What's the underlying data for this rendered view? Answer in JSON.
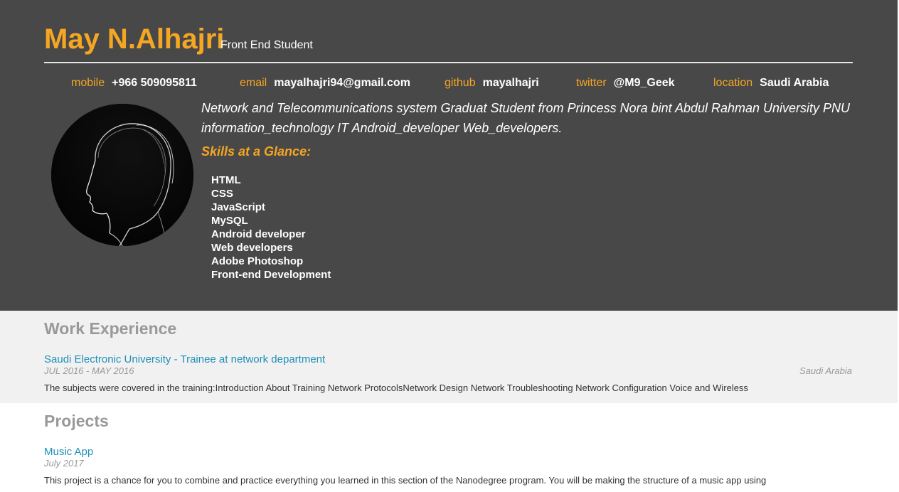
{
  "header": {
    "name": "May N.Alhajri",
    "role": "Front End Student",
    "contacts": [
      {
        "label": "mobile",
        "value": "+966 509095811"
      },
      {
        "label": "email",
        "value": "mayalhajri94@gmail.com"
      },
      {
        "label": "github",
        "value": "mayalhajri"
      },
      {
        "label": "twitter",
        "value": "@M9_Geek"
      },
      {
        "label": "location",
        "value": "Saudi Arabia"
      }
    ],
    "welcome_message": " Network and Telecommunications system Graduat Student from Princess Nora bint Abdul Rahman University PNU information_technology IT Android_developer Web_developers.",
    "skills_title": "Skills at a Glance:",
    "skills": [
      "HTML",
      "CSS",
      "JavaScript",
      "MySQL",
      "Android developer",
      "Web developers",
      "Adobe Photoshop",
      "Front-end Development"
    ]
  },
  "work": {
    "title": "Work Experience",
    "jobs": [
      {
        "employer_title": "Saudi Electronic University - Trainee at network department",
        "dates": "JUL 2016 - MAY 2016",
        "location": "Saudi Arabia",
        "description": "The subjects were covered in the training:Introduction About Training Network ProtocolsNetwork Design Network Troubleshooting Network Configuration Voice and Wireless"
      }
    ]
  },
  "projects": {
    "title": "Projects",
    "items": [
      {
        "title": "Music App",
        "dates": "July 2017",
        "description": "This project is a chance for you to combine and practice everything you learned in this section of the Nanodegree program. You will be making the structure of a music app using"
      }
    ]
  },
  "colors": {
    "header_bg": "#484848",
    "accent": "#f5a623",
    "link": "#1e90b8",
    "work_bg": "#f1f1f1",
    "muted": "#999999"
  }
}
